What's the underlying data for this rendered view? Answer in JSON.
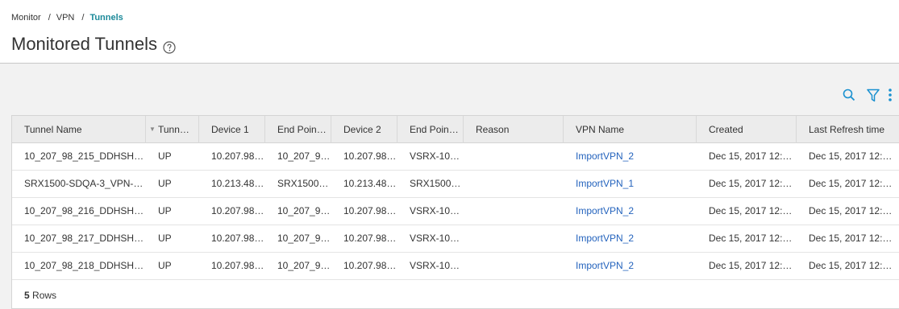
{
  "breadcrumb": {
    "items": [
      "Monitor",
      "VPN"
    ],
    "separator": "/",
    "current": "Tunnels"
  },
  "page": {
    "title": "Monitored Tunnels",
    "help_icon": "question-circle-icon"
  },
  "toolbar": {
    "icons": [
      "search-icon",
      "filter-icon",
      "more-vertical-icon"
    ],
    "accent": "#1a91d0"
  },
  "grid": {
    "columns": [
      "Tunnel Name",
      "Tunn…",
      "Device 1",
      "End Poin…",
      "Device 2",
      "End Poin…",
      "Reason",
      "VPN Name",
      "Created",
      "Last Refresh time"
    ],
    "sorted_column_icon": "sort-desc-icon",
    "rows": [
      [
        "10_207_98_215_DDHSH…",
        "UP",
        "10.207.98…",
        "10_207_9…",
        "10.207.98…",
        "VSRX-10…",
        "",
        "ImportVPN_2",
        "Dec 15, 2017 12:…",
        "Dec 15, 2017 12:…"
      ],
      [
        "SRX1500-SDQA-3_VPN-…",
        "UP",
        "10.213.48…",
        "SRX1500…",
        "10.213.48…",
        "SRX1500…",
        "",
        "ImportVPN_1",
        "Dec 15, 2017 12:…",
        "Dec 15, 2017 12:…"
      ],
      [
        "10_207_98_216_DDHSH…",
        "UP",
        "10.207.98…",
        "10_207_9…",
        "10.207.98…",
        "VSRX-10…",
        "",
        "ImportVPN_2",
        "Dec 15, 2017 12:…",
        "Dec 15, 2017 12:…"
      ],
      [
        "10_207_98_217_DDHSH…",
        "UP",
        "10.207.98…",
        "10_207_9…",
        "10.207.98…",
        "VSRX-10…",
        "",
        "ImportVPN_2",
        "Dec 15, 2017 12:…",
        "Dec 15, 2017 12:…"
      ],
      [
        "10_207_98_218_DDHSH…",
        "UP",
        "10.207.98…",
        "10_207_9…",
        "10.207.98…",
        "VSRX-10…",
        "",
        "ImportVPN_2",
        "Dec 15, 2017 12:…",
        "Dec 15, 2017 12:…"
      ]
    ],
    "footer": {
      "count": "5",
      "label": "Rows"
    }
  },
  "colors": {
    "link": "#2463bd",
    "breadcrumb_current": "#1c8a9a",
    "header_bg": "#ececec"
  }
}
